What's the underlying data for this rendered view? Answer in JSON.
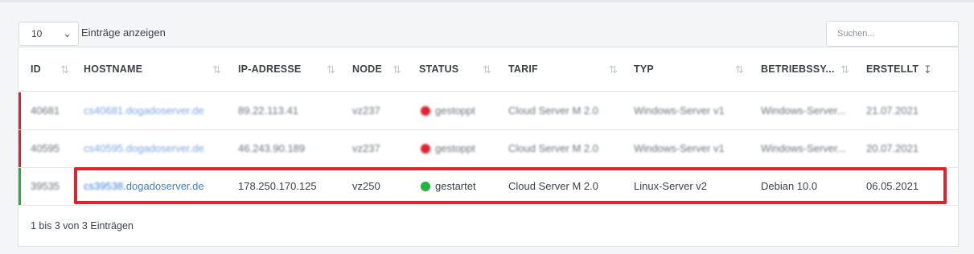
{
  "length_menu": {
    "value": "10",
    "label": "Einträge anzeigen"
  },
  "search": {
    "placeholder": "Suchen..."
  },
  "columns": [
    "ID",
    "HOSTNAME",
    "IP-ADRESSE",
    "NODE",
    "STATUS",
    "TARIF",
    "TYP",
    "BETRIEBSSY...",
    "ERSTELLT"
  ],
  "rows": [
    {
      "id": "40681",
      "hostname": "cs40681.dogadoserver.de",
      "ip": "89.22.113.41",
      "node": "vz237",
      "status": "gestoppt",
      "status_color": "#e0222e",
      "tarif": "Cloud Server M 2.0",
      "typ": "Windows-Server v1",
      "os": "Windows-Server...",
      "created": "21.07.2021",
      "bar_color": "#e0222e"
    },
    {
      "id": "40595",
      "hostname": "cs40595.dogadoserver.de",
      "ip": "46.243.90.189",
      "node": "vz237",
      "status": "gestoppt",
      "status_color": "#e0222e",
      "tarif": "Cloud Server M 2.0",
      "typ": "Windows-Server v1",
      "os": "Windows-Server...",
      "created": "20.07.2021",
      "bar_color": "#e0222e"
    },
    {
      "id": "39535",
      "hostname": "cs39538.dogadoserver.de",
      "ip": "178.250.170.125",
      "node": "vz250",
      "status": "gestartet",
      "status_color": "#22b33a",
      "tarif": "Cloud Server M 2.0",
      "typ": "Linux-Server v2",
      "os": "Debian 10.0",
      "created": "06.05.2021",
      "bar_color": "#22b33a"
    }
  ],
  "info": "1 bis 3 von 3 Einträgen",
  "colors": {
    "accent_link": "#3b7fd3",
    "highlight": "#e0222e"
  }
}
